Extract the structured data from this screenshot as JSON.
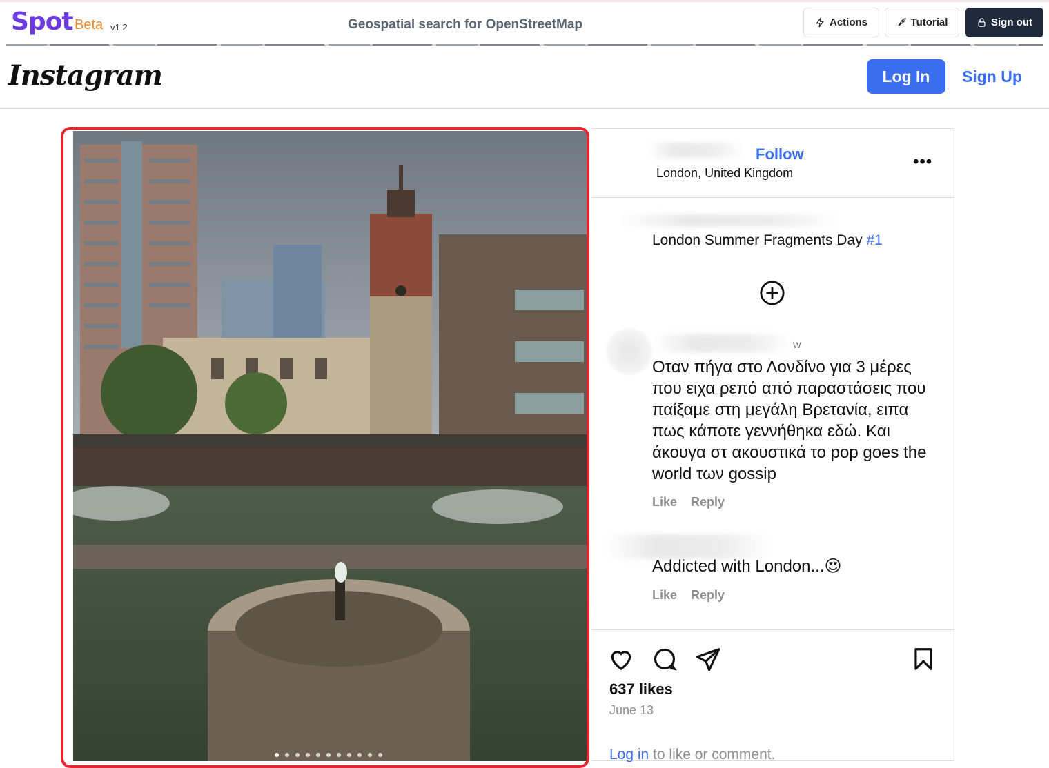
{
  "spot": {
    "logo": "Spot",
    "beta": "Beta",
    "version": "v1.2",
    "tagline": "Geospatial search for OpenStreetMap",
    "actions_label": "Actions",
    "tutorial_label": "Tutorial",
    "signout_label": "Sign out",
    "brand_color": "#6d3adf"
  },
  "instagram": {
    "logo": "Instagram",
    "login_label": "Log In",
    "signup_label": "Sign Up",
    "accent": "#3a6df0"
  },
  "post": {
    "follow_label": "Follow",
    "location": "London, United Kingdom",
    "more_label": "•••",
    "caption_text": "London Summer Fragments Day ",
    "caption_tag": "#1",
    "comments": [
      {
        "time": "w",
        "text": "Οταν πήγα στο Λονδίνο για 3 μέρες που ειχα ρεπό από παραστάσεις που παίξαμε στη μεγάλη Βρετανία, ειπα πως κάποτε γεννήθηκα εδώ. Και άκουγα στ ακουστικά το pop goes the world των gossip",
        "like": "Like",
        "reply": "Reply"
      },
      {
        "text": "Addicted with London...😍",
        "like": "Like",
        "reply": "Reply"
      }
    ],
    "likes": "637 likes",
    "date": "June 13",
    "login_link": "Log in",
    "login_rest": " to like or comment."
  }
}
